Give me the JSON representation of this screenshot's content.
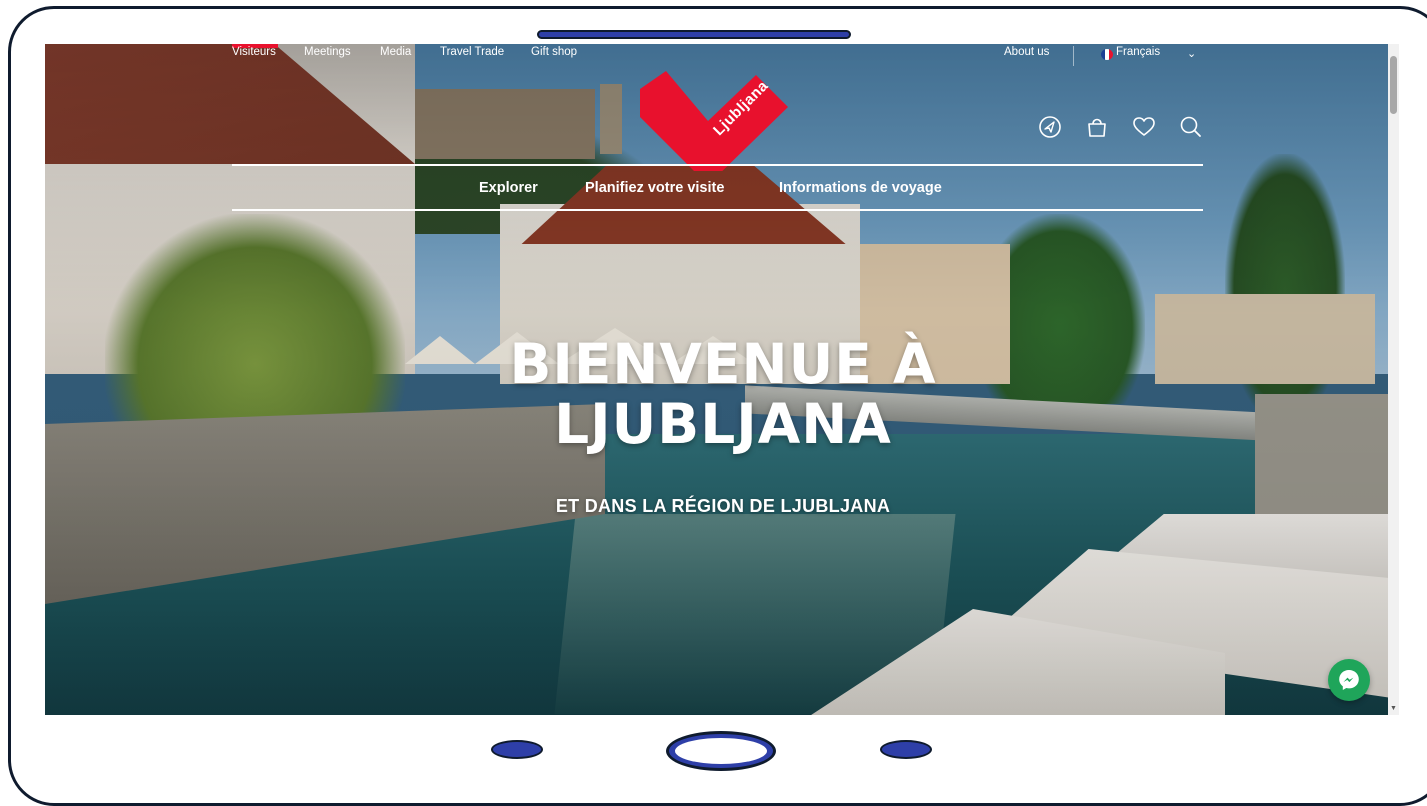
{
  "topnav": {
    "visitors": "Visiteurs",
    "meetings": "Meetings",
    "media": "Media",
    "travel_trade": "Travel Trade",
    "gift_shop": "Gift shop",
    "about_us": "About us",
    "language": "Français"
  },
  "logo": {
    "text": "Ljubljana"
  },
  "icons": [
    "compass-icon",
    "shopping-bag-icon",
    "heart-icon",
    "search-icon",
    "messenger-icon"
  ],
  "main_menu": {
    "explore": "Explorer",
    "plan": "Planifiez votre visite",
    "travel_info": "Informations de voyage"
  },
  "hero": {
    "title_line1": "BIENVENUE À",
    "title_line2": "LJUBLJANA",
    "subtitle": "ET DANS LA RÉGION DE LJUBLJANA"
  },
  "colors": {
    "brand_red": "#e8112d",
    "device_blue": "#2e3fa8",
    "messenger_green": "#1fa55a",
    "text_white": "#ffffff"
  }
}
